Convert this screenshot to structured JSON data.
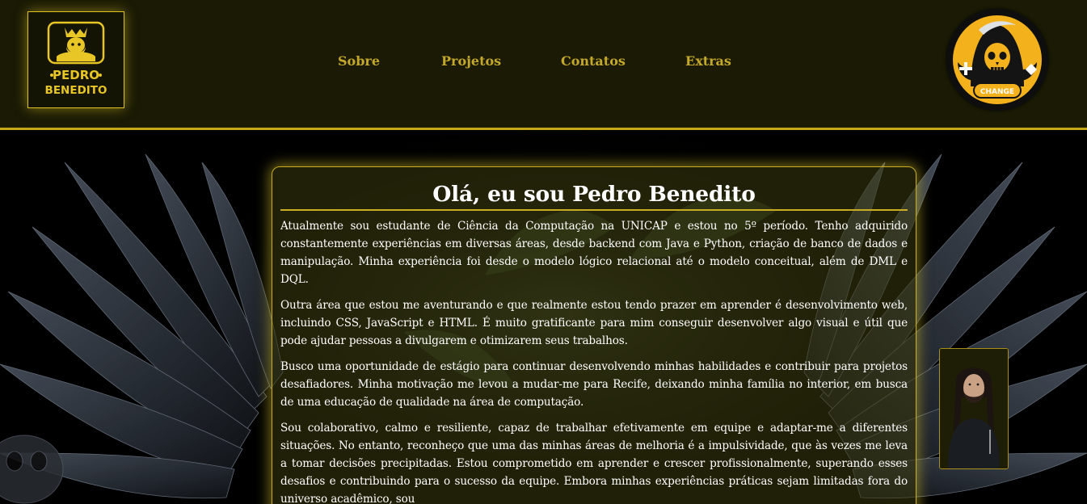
{
  "header": {
    "logo": {
      "line1": "PEDRO",
      "line2": "BENEDITO"
    },
    "nav": [
      {
        "label": "Sobre"
      },
      {
        "label": "Projetos"
      },
      {
        "label": "Contatos"
      },
      {
        "label": "Extras"
      }
    ],
    "theme_button": {
      "label": "CHANGE"
    }
  },
  "main": {
    "title": "Olá, eu sou Pedro Benedito",
    "paragraphs": [
      "Atualmente sou estudante de Ciência da Computação na UNICAP e estou no 5º período. Tenho adquirido constantemente experiências em diversas áreas, desde backend com Java e Python, criação de banco de dados e manipulação. Minha experiência foi desde o modelo lógico relacional até o modelo conceitual, além de DML e DQL.",
      "Outra área que estou me aventurando e que realmente estou tendo prazer em aprender é desenvolvimento web, incluindo CSS, JavaScript e HTML. É muito gratificante para mim conseguir desenvolver algo visual e útil que pode ajudar pessoas a divulgarem e otimizarem seus trabalhos.",
      "Busco uma oportunidade de estágio para continuar desenvolvendo minhas habilidades e contribuir para projetos desafiadores. Minha motivação me levou a mudar-me para Recife, deixando minha família no interior, em busca de uma educação de qualidade na área de computação.",
      "Sou colaborativo, calmo e resiliente, capaz de trabalhar efetivamente em equipe e adaptar-me a diferentes situações. No entanto, reconheço que uma das minhas áreas de melhoria é a impulsividade, que às vezes me leva a tomar decisões precipitadas. Estou comprometido em aprender e crescer profissionalmente, superando esses desafios e contribuindo para o sucesso da equipe. Embora minhas experiências práticas sejam limitadas fora do universo acadêmico, sou"
    ]
  },
  "colors": {
    "accent": "#c4a819",
    "header_bg": "#1a1a05",
    "nav_text": "#c4a82a",
    "text": "#ffffff",
    "page_bg": "#000000"
  },
  "icons": {
    "logo": "bearded-man-crown-icon",
    "theme_button": "grim-reaper-gamer-icon"
  }
}
